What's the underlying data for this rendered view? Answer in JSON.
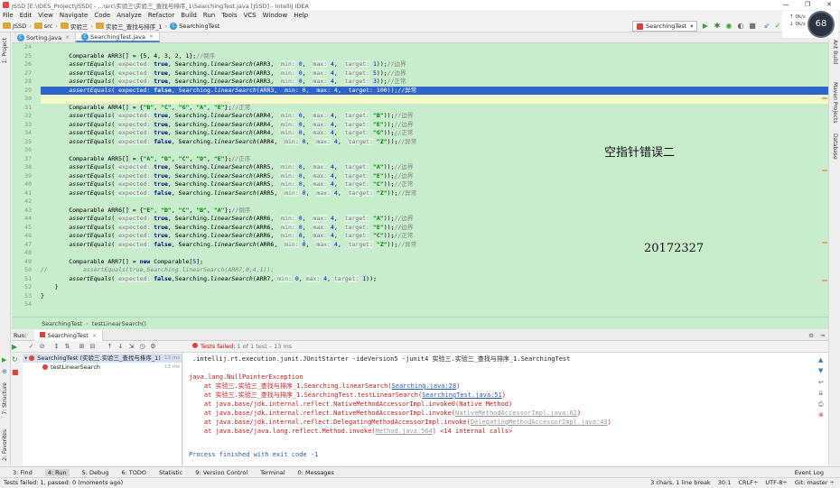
{
  "window": {
    "title": "JSSD [E:\\IDES_Project\\JSSD] - ...\\src\\实验三\\实验三_查找与排序_1\\SearchingTest.java [JSSD] - IntelliJ IDEA",
    "controls": [
      "—",
      "❐",
      "✕"
    ]
  },
  "menu": [
    "File",
    "Edit",
    "View",
    "Navigate",
    "Code",
    "Analyze",
    "Refactor",
    "Build",
    "Run",
    "Tools",
    "VCS",
    "Window",
    "Help"
  ],
  "nav": {
    "crumbs": [
      "JSSD",
      "src",
      "实验三",
      "实验三_查找与排序_1",
      "SearchingTest"
    ],
    "run_config": "SearchingTest"
  },
  "perf": {
    "up": "0k/s",
    "down": "0k/s",
    "gauge": "68"
  },
  "left_strip": {
    "project": "1: Project",
    "structure": "7: Structure",
    "favorites": "2: Favorites"
  },
  "right_strip": {
    "ant": "Ant Build",
    "maven": "Maven Projects",
    "database": "Database"
  },
  "editor": {
    "tabs": [
      {
        "label": "Sorting.java",
        "active": false
      },
      {
        "label": "SearchingTest.java",
        "active": true
      }
    ],
    "line_numbers": [
      "24",
      "25",
      "26",
      "27",
      "28",
      "29",
      "30",
      "31",
      "32",
      "33",
      "34",
      "35",
      "36",
      "37",
      "38",
      "39",
      "40",
      "41",
      "42",
      "43",
      "44",
      "45",
      "46",
      "47",
      "48",
      "49",
      "50",
      "51",
      "52",
      "53",
      "54"
    ],
    "annotation1": "空指针错误二",
    "annotation2": "20172327",
    "breadcrumb": [
      "SearchingTest",
      "testLinearSearch()"
    ]
  },
  "run": {
    "panel_label": "Run:",
    "tab": "SearchingTest",
    "fail_summary": "Tests failed:",
    "fail_detail": "1 of 1 test – 13 ms",
    "tree": [
      {
        "label": "SearchingTest (实验三.实验三_查找与排序_1)",
        "ms": "13 ms"
      },
      {
        "label": "testLinearSearch",
        "ms": "13 ms"
      }
    ],
    "console": {
      "cmd": ".intellij.rt.execution.junit.JUnitStarter -ideVersion5 -junit4 实验三.实验三_查找与排序_1.SearchingTest",
      "exception": "java.lang.NullPointerException",
      "trace": [
        {
          "pre": "    at 实验三.实验三_查找与排序_1.Searching.linearSearch(",
          "link": "Searching.java:28",
          "post": ")",
          "gray": false
        },
        {
          "pre": "    at 实验三.实验三_查找与排序_1.SearchingTest.testLinearSearch(",
          "link": "SearchingTest.java:51",
          "post": ")",
          "gray": false
        },
        {
          "pre": "    at java.base/jdk.internal.reflect.NativeMethodAccessorImpl.invoke0(Native Method)",
          "link": "",
          "post": "",
          "gray": false
        },
        {
          "pre": "    at java.base/jdk.internal.reflect.NativeMethodAccessorImpl.invoke(",
          "link": "NativeMethodAccessorImpl.java:62",
          "post": ")",
          "gray": true
        },
        {
          "pre": "    at java.base/jdk.internal.reflect.DelegatingMethodAccessorImpl.invoke(",
          "link": "DelegatingMethodAccessorImpl.java:43",
          "post": ")",
          "gray": true
        },
        {
          "pre": "    at java.base/java.lang.reflect.Method.invoke(",
          "link": "Method.java:564",
          "post": ") <14 internal calls>",
          "gray": true
        }
      ],
      "finished": "Process finished with exit code -1"
    }
  },
  "tool_buttons": [
    "3: Find",
    "4: Run",
    "5: Debug",
    "6: TODO",
    "Statistic",
    "9: Version Control",
    "Terminal",
    "0: Messages"
  ],
  "event_log": "Event Log",
  "status": {
    "left": "Tests failed: 1, passed: 0 (moments ago)",
    "chars": "3 chars, 1 line break",
    "pos": "30:1",
    "crlf": "CRLF÷",
    "enc": "UTF-8÷",
    "git": "Git: master ÷"
  },
  "colors": {
    "editor_bg": "#c7edcc",
    "selection": "#2f65ca",
    "error": "#c91b1b",
    "link": "#2a5db0"
  }
}
